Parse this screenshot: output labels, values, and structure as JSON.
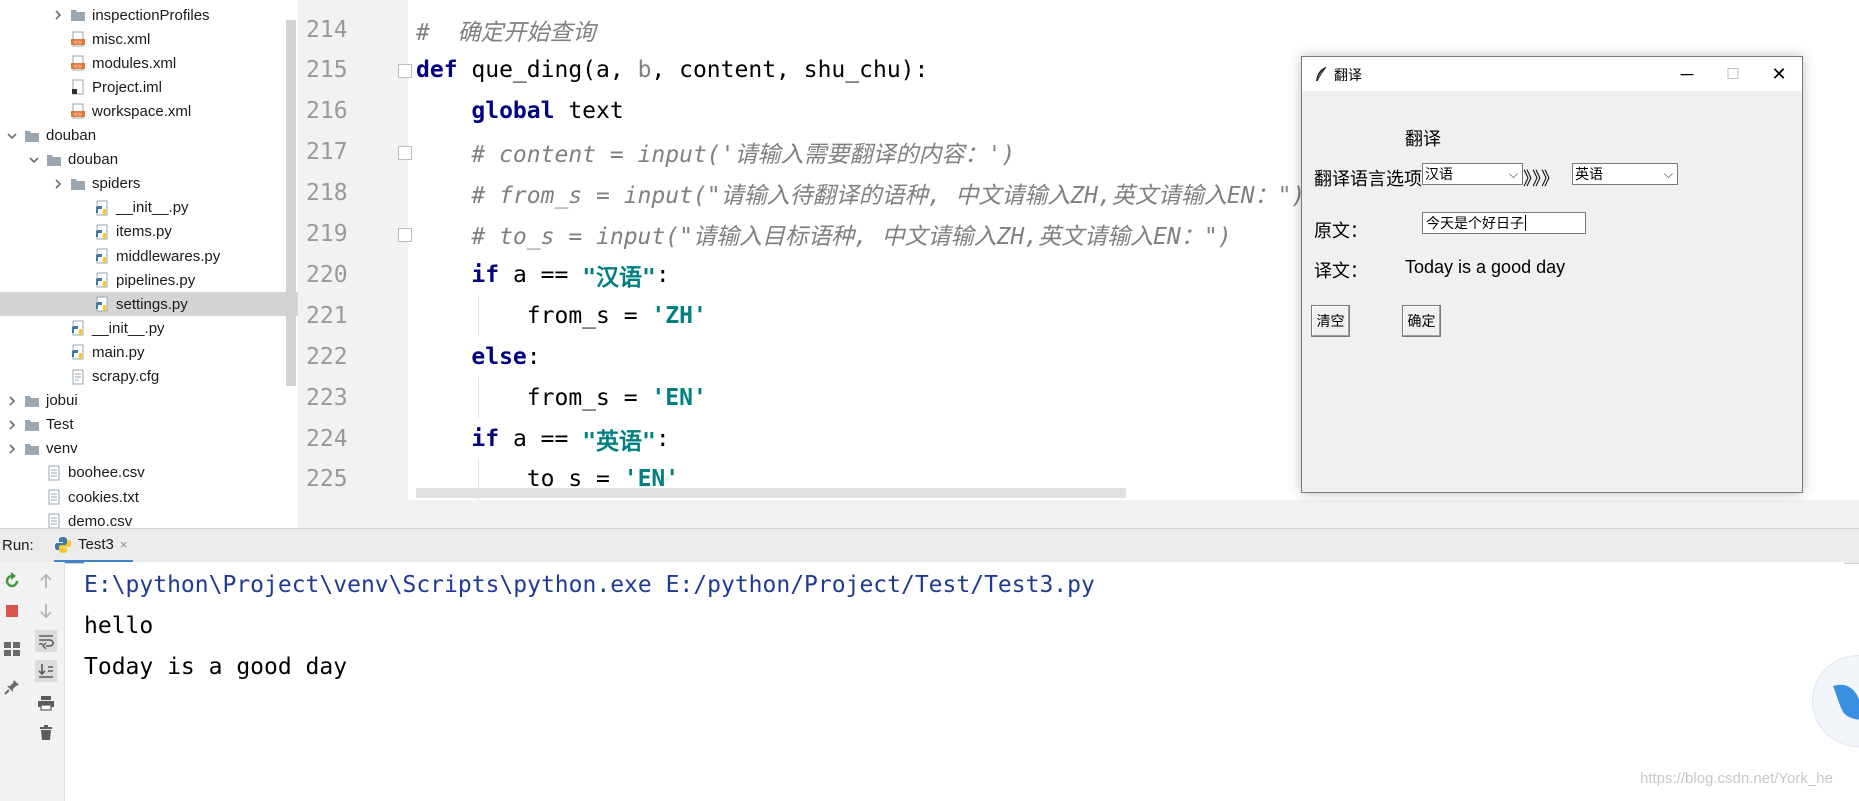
{
  "project_tree": {
    "items": [
      {
        "label": "inspectionProfiles",
        "type": "folder",
        "arrow": "collapsed",
        "depth": 2
      },
      {
        "label": "misc.xml",
        "type": "xml",
        "arrow": "",
        "depth": 2
      },
      {
        "label": "modules.xml",
        "type": "xml",
        "arrow": "",
        "depth": 2
      },
      {
        "label": "Project.iml",
        "type": "iml",
        "arrow": "",
        "depth": 2
      },
      {
        "label": "workspace.xml",
        "type": "xml",
        "arrow": "",
        "depth": 2
      },
      {
        "label": "douban",
        "type": "folder",
        "arrow": "expanded",
        "depth": 0
      },
      {
        "label": "douban",
        "type": "folder",
        "arrow": "expanded",
        "depth": 1
      },
      {
        "label": "spiders",
        "type": "folder",
        "arrow": "collapsed",
        "depth": 2
      },
      {
        "label": "__init__.py",
        "type": "py",
        "arrow": "",
        "depth": 3
      },
      {
        "label": "items.py",
        "type": "py",
        "arrow": "",
        "depth": 3
      },
      {
        "label": "middlewares.py",
        "type": "py",
        "arrow": "",
        "depth": 3
      },
      {
        "label": "pipelines.py",
        "type": "py",
        "arrow": "",
        "depth": 3
      },
      {
        "label": "settings.py",
        "type": "py",
        "arrow": "",
        "depth": 3,
        "selected": true
      },
      {
        "label": "__init__.py",
        "type": "py",
        "arrow": "",
        "depth": 2
      },
      {
        "label": "main.py",
        "type": "py",
        "arrow": "",
        "depth": 2
      },
      {
        "label": "scrapy.cfg",
        "type": "cfg",
        "arrow": "",
        "depth": 2
      },
      {
        "label": "jobui",
        "type": "folder",
        "arrow": "collapsed",
        "depth": 0
      },
      {
        "label": "Test",
        "type": "folder",
        "arrow": "collapsed",
        "depth": 0
      },
      {
        "label": "venv",
        "type": "folder",
        "arrow": "collapsed",
        "depth": 0
      },
      {
        "label": "boohee.csv",
        "type": "file",
        "arrow": "",
        "depth": 1
      },
      {
        "label": "cookies.txt",
        "type": "file",
        "arrow": "",
        "depth": 1
      },
      {
        "label": "demo.csv",
        "type": "file",
        "arrow": "",
        "depth": 1
      }
    ]
  },
  "editor": {
    "lines": [
      {
        "no": "214",
        "tokens": [
          {
            "t": "#  确定开始查询",
            "c": "cm"
          }
        ]
      },
      {
        "no": "215",
        "tokens": [
          {
            "t": "def",
            "c": "kw"
          },
          {
            "t": " que_ding(a, ",
            "c": ""
          },
          {
            "t": "b",
            "c": "param-unused"
          },
          {
            "t": ", content, shu_chu):",
            "c": ""
          }
        ]
      },
      {
        "no": "216",
        "tokens": [
          {
            "t": "    ",
            "c": ""
          },
          {
            "t": "global",
            "c": "kw"
          },
          {
            "t": " text",
            "c": ""
          }
        ]
      },
      {
        "no": "217",
        "tokens": [
          {
            "t": "    ",
            "c": ""
          },
          {
            "t": "# content = input('请输入需要翻译的内容：')",
            "c": "cm"
          }
        ]
      },
      {
        "no": "218",
        "tokens": [
          {
            "t": "    ",
            "c": ""
          },
          {
            "t": "# from_s = input(\"请输入待翻译的语种, 中文请输入ZH,英文请输入EN：\")",
            "c": "cm"
          }
        ]
      },
      {
        "no": "219",
        "tokens": [
          {
            "t": "    ",
            "c": ""
          },
          {
            "t": "# to_s = input(\"请输入目标语种, 中文请输入ZH,英文请输入EN：\")",
            "c": "cm"
          }
        ]
      },
      {
        "no": "220",
        "tokens": [
          {
            "t": "    ",
            "c": ""
          },
          {
            "t": "if",
            "c": "kw"
          },
          {
            "t": " a == ",
            "c": ""
          },
          {
            "t": "\"汉语\"",
            "c": "str"
          },
          {
            "t": ":",
            "c": ""
          }
        ]
      },
      {
        "no": "221",
        "tokens": [
          {
            "t": "        from_s = ",
            "c": ""
          },
          {
            "t": "'ZH'",
            "c": "str"
          }
        ]
      },
      {
        "no": "222",
        "tokens": [
          {
            "t": "    ",
            "c": ""
          },
          {
            "t": "else",
            "c": "kw"
          },
          {
            "t": ":",
            "c": ""
          }
        ]
      },
      {
        "no": "223",
        "tokens": [
          {
            "t": "        from_s = ",
            "c": ""
          },
          {
            "t": "'EN'",
            "c": "str"
          }
        ]
      },
      {
        "no": "224",
        "tokens": [
          {
            "t": "    ",
            "c": ""
          },
          {
            "t": "if",
            "c": "kw"
          },
          {
            "t": " a == ",
            "c": ""
          },
          {
            "t": "\"英语\"",
            "c": "str"
          },
          {
            "t": ":",
            "c": ""
          }
        ]
      },
      {
        "no": "225",
        "tokens": [
          {
            "t": "        to_s = ",
            "c": ""
          },
          {
            "t": "'EN'",
            "c": "str"
          }
        ]
      }
    ]
  },
  "tk_window": {
    "title": "翻译",
    "minimize": "─",
    "maximize": "☐",
    "close": "✕",
    "heading": "翻译",
    "lang_label": "翻译语言选项",
    "source_lang": "汉语",
    "arrows": "》》》",
    "target_lang": "英语",
    "original_label": "原文：",
    "original_text": "今天是个好日子",
    "translation_label": "译文：",
    "translation_text": "Today is a good day",
    "clear_button": "清空",
    "confirm_button": "确定"
  },
  "run_panel": {
    "label": "Run:",
    "tab": "Test3",
    "tab_close": "×",
    "console": [
      {
        "text": "E:\\python\\Project\\venv\\Scripts\\python.exe E:/python/Project/Test/Test3.py",
        "color": "#1f3a93"
      },
      {
        "text": "hello",
        "color": "#000000"
      },
      {
        "text": "Today is a good day",
        "color": "#000000"
      }
    ]
  },
  "watermark": "https://blog.csdn.net/York_he",
  "colors": {
    "keyword": "#000080",
    "string": "#008080",
    "comment": "#808080",
    "selection": "#d4d4d4",
    "run_tab_underline": "#4083c9"
  }
}
